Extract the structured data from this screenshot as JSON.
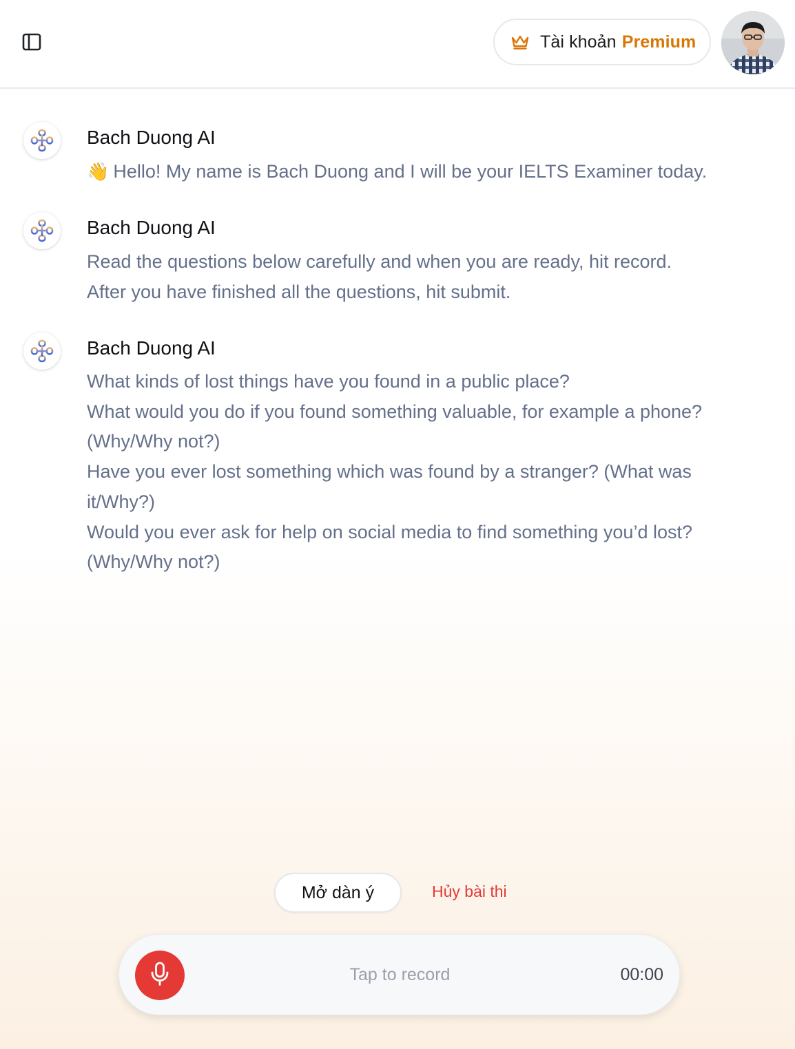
{
  "header": {
    "sidebar_toggle_icon": "sidebar-panel-icon",
    "premium": {
      "icon": "crown-icon",
      "label": "Tài khoản",
      "accent": "Premium",
      "accent_color": "#d97706"
    },
    "avatar_icon": "user-avatar"
  },
  "messages": [
    {
      "sender": "Bach Duong AI",
      "emoji": "👋",
      "lines": [
        "Hello! My name is Bach Duong and I will be your IELTS Examiner today."
      ]
    },
    {
      "sender": "Bach Duong AI",
      "lines": [
        "Read the questions below carefully and when you are ready, hit record.",
        "After you have finished all the questions, hit submit."
      ]
    },
    {
      "sender": "Bach Duong AI",
      "lines": [
        "What kinds of lost things have you found in a public place?",
        "What would you do if you found something valuable, for example a phone?",
        "(Why/Why not?)",
        "Have you ever lost something which was found by a stranger? (What was",
        "it/Why?)",
        "Would you ever ask for help on social media to find something you’d lost?",
        "(Why/Why not?)"
      ]
    }
  ],
  "actions": {
    "outline_label": "Mở dàn ý",
    "cancel_label": "Hủy bài thi",
    "cancel_color": "#e53935"
  },
  "recorder": {
    "mic_icon": "microphone-icon",
    "hint": "Tap to record",
    "timer": "00:00",
    "mic_color": "#e53935"
  }
}
